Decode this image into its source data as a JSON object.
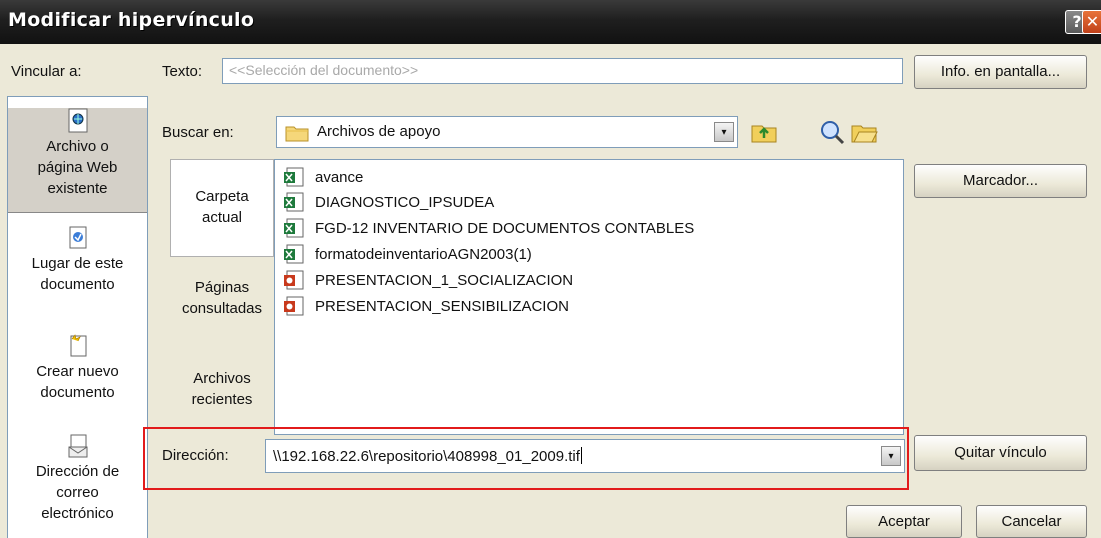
{
  "window": {
    "title": "Modificar hipervínculo",
    "help_glyph": "?",
    "close_glyph": "✕"
  },
  "link_to": {
    "label": "Vincular a:",
    "items": [
      {
        "line1": "Archivo o",
        "line2": "página Web",
        "line3": "existente",
        "icon": "web-page-icon"
      },
      {
        "line1": "Lugar de este",
        "line2": "documento",
        "icon": "document-place-icon"
      },
      {
        "line1": "Crear nuevo",
        "line2": "documento",
        "icon": "new-document-icon"
      },
      {
        "line1": "Dirección de",
        "line2": "correo",
        "line3": "electrónico",
        "icon": "email-icon"
      }
    ]
  },
  "text_field": {
    "label": "Texto:",
    "value": "<<Selección del documento>>"
  },
  "buttons": {
    "screentip": "Info. en pantalla...",
    "bookmark": "Marcador...",
    "remove_link": "Quitar vínculo",
    "ok": "Aceptar",
    "cancel": "Cancelar"
  },
  "look_in": {
    "label": "Buscar en:",
    "value": "Archivos de apoyo",
    "dropdown_glyph": "▾"
  },
  "places": {
    "current_folder": [
      "Carpeta",
      "actual"
    ],
    "browsed_pages": [
      "Páginas",
      "consultadas"
    ],
    "recent_files": [
      "Archivos",
      "recientes"
    ]
  },
  "files": [
    {
      "name": "avance",
      "type": "excel"
    },
    {
      "name": "DIAGNOSTICO_IPSUDEA",
      "type": "excel"
    },
    {
      "name": "FGD-12 INVENTARIO DE DOCUMENTOS CONTABLES",
      "type": "excel"
    },
    {
      "name": "formatodeinventarioAGN2003(1)",
      "type": "excel"
    },
    {
      "name": "PRESENTACION_1_SOCIALIZACION",
      "type": "powerpoint"
    },
    {
      "name": "PRESENTACION_SENSIBILIZACION",
      "type": "powerpoint"
    }
  ],
  "address": {
    "label": "Dirección:",
    "value": "\\\\192.168.22.6\\repositorio\\408998_01_2009.tif",
    "dropdown_glyph": "▾"
  },
  "colors": {
    "highlight_frame": "#e21b1b",
    "titlebar": "#1f1f1f",
    "dialog_bg": "#ece9d8"
  }
}
